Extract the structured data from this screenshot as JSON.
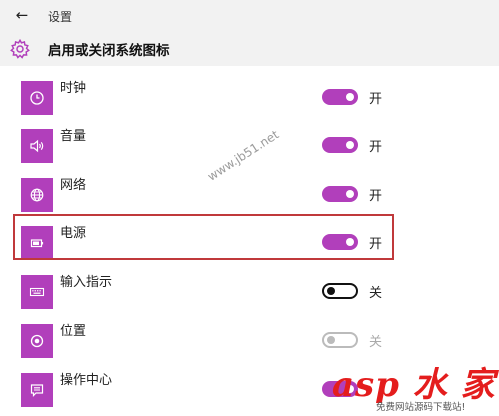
{
  "titlebar": {
    "back_icon": "back-arrow-icon",
    "title": "设置"
  },
  "header": {
    "icon": "gear-icon",
    "title": "启用或关闭系统图标"
  },
  "items": [
    {
      "label": "时钟",
      "icon": "clock-icon",
      "state": "on",
      "state_text": "开"
    },
    {
      "label": "音量",
      "icon": "volume-icon",
      "state": "on",
      "state_text": "开"
    },
    {
      "label": "网络",
      "icon": "globe-icon",
      "state": "on",
      "state_text": "开"
    },
    {
      "label": "电源",
      "icon": "battery-icon",
      "state": "on",
      "state_text": "开"
    },
    {
      "label": "输入指示",
      "icon": "keyboard-icon",
      "state": "off",
      "state_text": "关"
    },
    {
      "label": "位置",
      "icon": "location-icon",
      "state": "disabled",
      "state_text": "关"
    },
    {
      "label": "操作中心",
      "icon": "action-center-icon",
      "state": "on",
      "state_text": ""
    }
  ],
  "colors": {
    "accent": "#b13fbb",
    "highlight": "#c0393b",
    "logo": "#e41d1d"
  },
  "watermark": {
    "text": "www.jb51.net"
  },
  "logo": {
    "text": "asp 水 家",
    "subtitle": "免费网站源码下载站!"
  }
}
